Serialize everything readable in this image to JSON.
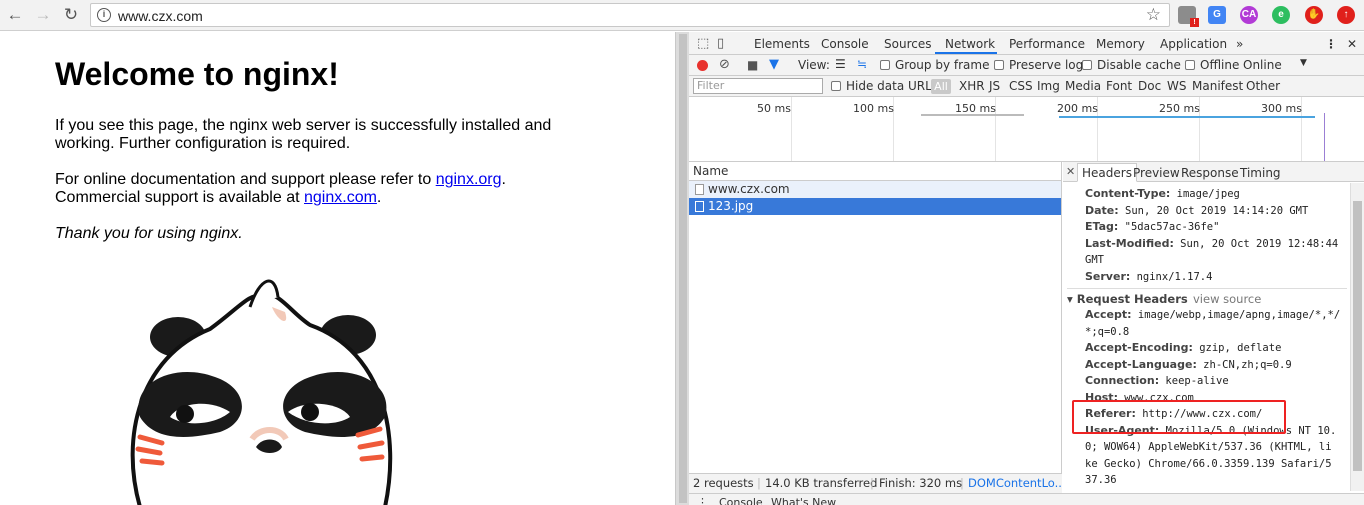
{
  "browser": {
    "url": "www.czx.com",
    "back_icon": "arrow-left",
    "forward_icon": "arrow-right",
    "reload_icon": "reload",
    "star_icon": "star",
    "extensions": [
      {
        "name": "ext-badge-icon",
        "color": "#8c8c8c"
      },
      {
        "name": "translate-icon",
        "color": "#4285f4"
      },
      {
        "name": "ca-icon",
        "color": "#b23bd6"
      },
      {
        "name": "evernote-icon",
        "color": "#2dbe60"
      },
      {
        "name": "adblock-icon",
        "color": "#e0201b"
      },
      {
        "name": "upload-icon",
        "color": "#e0201b"
      }
    ]
  },
  "page": {
    "title": "Welcome to nginx!",
    "p1": "If you see this page, the nginx web server is successfully installed and working. Further configuration is required.",
    "p2_a": "For online documentation and support please refer to ",
    "p2_link1": "nginx.org",
    "p2_b": ".",
    "p2_c": "Commercial support is available at ",
    "p2_link2": "nginx.com",
    "p2_d": ".",
    "thanks": "Thank you for using nginx."
  },
  "devtools": {
    "tabs": [
      "Elements",
      "Console",
      "Sources",
      "Network",
      "Performance",
      "Memory",
      "Application"
    ],
    "active_tab": "Network",
    "more": "»",
    "toolbar": {
      "view": "View:",
      "group_by_frame": "Group by frame",
      "preserve_log": "Preserve log",
      "disable_cache": "Disable cache",
      "offline": "Offline",
      "throttle": "Online"
    },
    "filter": {
      "placeholder": "Filter",
      "hide_data_urls": "Hide data URLs",
      "types": [
        "All",
        "XHR",
        "JS",
        "CSS",
        "Img",
        "Media",
        "Font",
        "Doc",
        "WS",
        "Manifest",
        "Other"
      ]
    },
    "timeline_ticks": [
      "50 ms",
      "100 ms",
      "150 ms",
      "200 ms",
      "250 ms",
      "300 ms"
    ],
    "name_header": "Name",
    "requests": [
      {
        "name": "www.czx.com",
        "selected": false
      },
      {
        "name": "123.jpg",
        "selected": true
      }
    ],
    "detail_tabs": [
      "Headers",
      "Preview",
      "Response",
      "Timing"
    ],
    "response_headers": [
      {
        "k": "Content-Type:",
        "v": "image/jpeg"
      },
      {
        "k": "Date:",
        "v": "Sun, 20 Oct 2019 14:14:20 GMT"
      },
      {
        "k": "ETag:",
        "v": "\"5dac57ac-36fe\""
      },
      {
        "k": "Last-Modified:",
        "v": "Sun, 20 Oct 2019 12:48:44"
      },
      {
        "k": "",
        "v": "GMT"
      },
      {
        "k": "Server:",
        "v": "nginx/1.17.4"
      }
    ],
    "request_section": "▾ Request Headers",
    "view_source": "view source",
    "request_headers": [
      {
        "k": "Accept:",
        "v": "image/webp,image/apng,image/*,*/"
      },
      {
        "k": "",
        "v": "*;q=0.8"
      },
      {
        "k": "Accept-Encoding:",
        "v": "gzip, deflate"
      },
      {
        "k": "Accept-Language:",
        "v": "zh-CN,zh;q=0.9"
      },
      {
        "k": "Connection:",
        "v": "keep-alive"
      },
      {
        "k": "Host:",
        "v": "www.czx.com"
      },
      {
        "k": "Referer:",
        "v": "http://www.czx.com/"
      },
      {
        "k": "User-Agent:",
        "v": "Mozilla/5.0 (Windows NT 10."
      },
      {
        "k": "",
        "v": "0; WOW64) AppleWebKit/537.36 (KHTML, li"
      },
      {
        "k": "",
        "v": "ke Gecko) Chrome/66.0.3359.139 Safari/5"
      },
      {
        "k": "",
        "v": "37.36"
      }
    ],
    "status": {
      "requests": "2 requests",
      "transferred": "14.0 KB transferred",
      "finish": "Finish: 320 ms",
      "dcl": "DOMContentLo..."
    },
    "drawer_tabs": [
      "Console",
      "What's New"
    ],
    "colors": {
      "accent": "#1a73e8",
      "selected_row": "#3879d9",
      "record": "#e8322d",
      "highlight": "#e22222"
    }
  }
}
